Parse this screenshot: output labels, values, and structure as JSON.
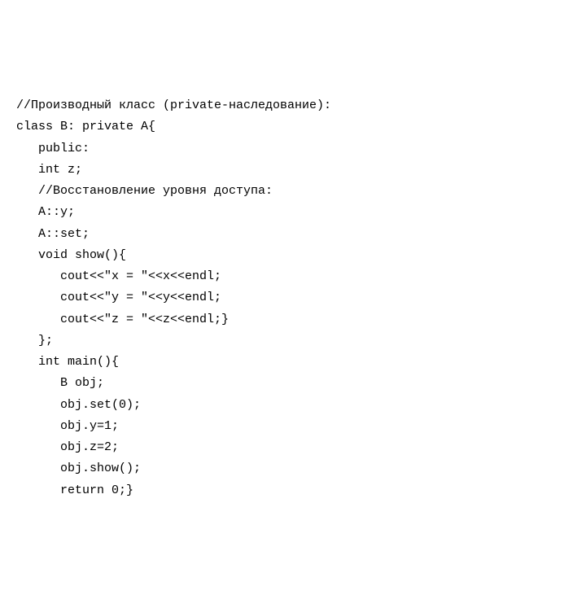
{
  "code": {
    "lines": [
      "//Производный класс (private-наследование):",
      "class B: private A{",
      "   public:",
      "   int z;",
      "   //Восстановление уровня доступа:",
      "   A::y;",
      "   A::set;",
      "   void show(){",
      "      cout<<\"x = \"<<x<<endl;",
      "      cout<<\"y = \"<<y<<endl;",
      "      cout<<\"z = \"<<z<<endl;}",
      "   };",
      "   int main(){",
      "      B obj;",
      "      obj.set(0);",
      "      obj.y=1;",
      "      obj.z=2;",
      "      obj.show();",
      "      return 0;}"
    ]
  }
}
